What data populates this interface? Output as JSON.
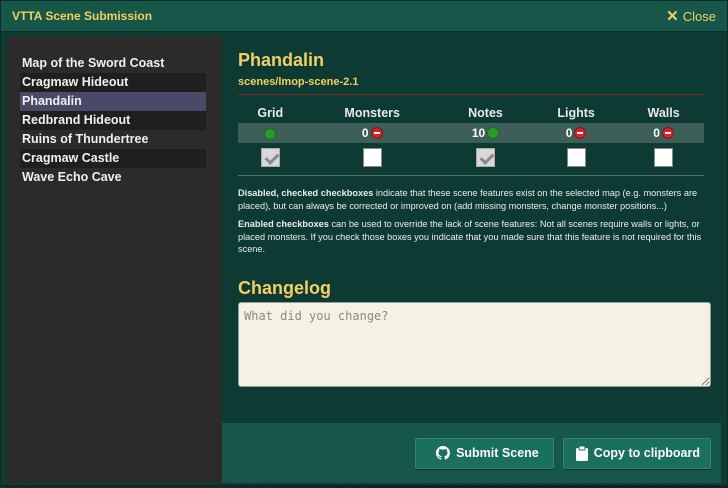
{
  "window": {
    "title": "VTTA Scene Submission",
    "close_label": "Close"
  },
  "sidebar": {
    "items": [
      {
        "label": "Map of the Sword Coast",
        "active": false
      },
      {
        "label": "Cragmaw Hideout",
        "active": false
      },
      {
        "label": "Phandalin",
        "active": true
      },
      {
        "label": "Redbrand Hideout",
        "active": false
      },
      {
        "label": "Ruins of Thundertree",
        "active": false
      },
      {
        "label": "Cragmaw Castle",
        "active": false
      },
      {
        "label": "Wave Echo Cave",
        "active": false
      }
    ]
  },
  "scene": {
    "title": "Phandalin",
    "path": "scenes/lmop-scene-2.1"
  },
  "features": {
    "headers": [
      "Grid",
      "Monsters",
      "Notes",
      "Lights",
      "Walls"
    ],
    "status": [
      {
        "count": "",
        "state": "ok"
      },
      {
        "count": "0",
        "state": "bad"
      },
      {
        "count": "10",
        "state": "ok"
      },
      {
        "count": "0",
        "state": "bad"
      },
      {
        "count": "0",
        "state": "bad"
      }
    ],
    "checkboxes": [
      {
        "checked": true,
        "disabled": true
      },
      {
        "checked": false,
        "disabled": false
      },
      {
        "checked": true,
        "disabled": true
      },
      {
        "checked": false,
        "disabled": false
      },
      {
        "checked": false,
        "disabled": false
      }
    ]
  },
  "help": {
    "p1_bold": "Disabled, checked checkboxes",
    "p1_rest": " indicate that these scene features exist on the selected map (e.g. monsters are placed), but can always be corrected or improved on (add missing monsters, change monster positions...)",
    "p2_bold": "Enabled checkboxes",
    "p2_rest": " can be used to override the lack of scene features: Not all scenes require walls or lights, or placed monsters. If you check those boxes you indicate that you made sure that this feature is not required for this scene."
  },
  "changelog": {
    "title": "Changelog",
    "value": "",
    "placeholder": "What did you change?"
  },
  "footer": {
    "submit_label": "Submit Scene",
    "copy_label": "Copy to clipboard"
  },
  "icons": {
    "submit": "github-icon",
    "copy": "clipboard-icon",
    "close": "close-icon",
    "ok": "check-circle-icon",
    "bad": "minus-circle-icon"
  },
  "colors": {
    "accent": "#f2cf63",
    "window_bg": "#0f3b33",
    "titlebar_bg": "#16574a",
    "sidebar_bg": "#2b2b2b",
    "active_item_bg": "#4a4a68",
    "ok": "#2b9a2b",
    "bad": "#d2232a"
  }
}
